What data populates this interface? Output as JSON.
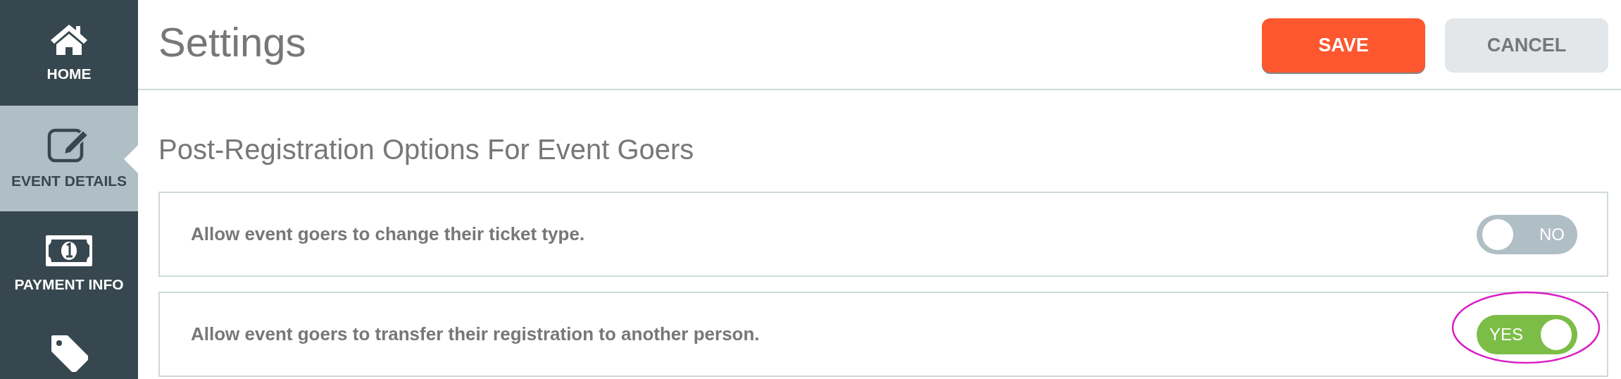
{
  "sidebar": {
    "items": [
      {
        "label": "HOME",
        "selected": false
      },
      {
        "label": "EVENT DETAILS",
        "selected": true
      },
      {
        "label": "PAYMENT INFO",
        "selected": false
      },
      {
        "selected": false
      }
    ]
  },
  "header": {
    "title": "Settings",
    "buttons": [
      {
        "label": "SAVE",
        "kind": "primary"
      },
      {
        "label": "CANCEL",
        "kind": "secondary"
      }
    ]
  },
  "section": {
    "title": "Post-Registration Options For Event Goers",
    "options": [
      {
        "label": "Allow event goers to change their ticket type.",
        "on": false,
        "toggle_text": "NO",
        "highlighted": false
      },
      {
        "label": "Allow event goers to transfer their registration to another person.",
        "on": true,
        "toggle_text": "YES",
        "highlighted": true
      }
    ]
  }
}
